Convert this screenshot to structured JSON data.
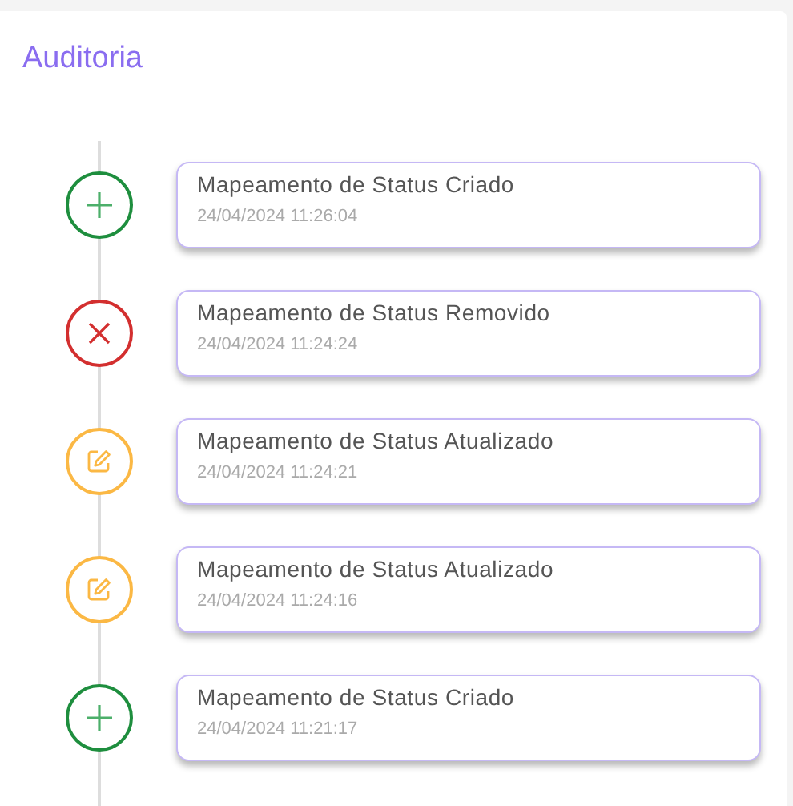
{
  "title": "Auditoria",
  "events": [
    {
      "kind": "created",
      "title": "Mapeamento de Status Criado",
      "time": "24/04/2024 11:26:04"
    },
    {
      "kind": "removed",
      "title": "Mapeamento de Status Removido",
      "time": "24/04/2024 11:24:24"
    },
    {
      "kind": "updated",
      "title": "Mapeamento de Status Atualizado",
      "time": "24/04/2024 11:24:21"
    },
    {
      "kind": "updated",
      "title": "Mapeamento de Status Atualizado",
      "time": "24/04/2024 11:24:16"
    },
    {
      "kind": "created",
      "title": "Mapeamento de Status Criado",
      "time": "24/04/2024 11:21:17"
    }
  ]
}
